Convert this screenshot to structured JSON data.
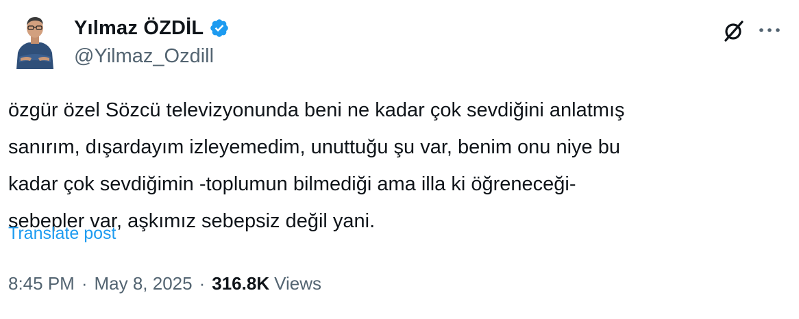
{
  "author": {
    "display_name": "Yılmaz ÖZDİL",
    "handle": "@Yilmaz_Ozdill",
    "verified": true,
    "verified_color": "#1d9bf0"
  },
  "post": {
    "lines": [
      "özgür özel Sözcü televizyonunda beni ne kadar çok sevdiğini anlatmış",
      "sanırım, dışardayım izleyemedim, unuttuğu şu var, benim onu niye bu",
      "kadar çok sevdiğimin -toplumun bilmediği ama illa ki öğreneceği-",
      "sebepler var, aşkımız sebepsiz değil yani."
    ],
    "translate_label": "Translate post"
  },
  "meta": {
    "time": "8:45 PM",
    "separator": "·",
    "date": "May 8, 2025",
    "views_count": "316.8K",
    "views_label": "Views"
  },
  "icons": {
    "grok": "grok-icon",
    "more": "more-icon",
    "verified": "verified-badge-icon"
  },
  "colors": {
    "text": "#0f1419",
    "secondary": "#536471",
    "link": "#1d9bf0"
  }
}
